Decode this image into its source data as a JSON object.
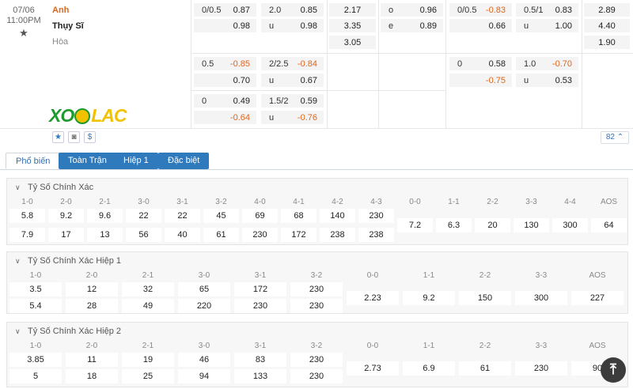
{
  "match": {
    "date": "07/06",
    "time": "11:00PM",
    "home": "Anh",
    "away": "Thụy Sĩ",
    "draw": "Hòa",
    "logo_left": "XO",
    "logo_right": "LAC",
    "more_count": "82"
  },
  "odds": {
    "r1": {
      "hdp": [
        "0/0.5",
        "0.87",
        "0.98"
      ],
      "ou": [
        "2.0",
        "0.85",
        "u",
        "0.98"
      ],
      "x12": [
        "2.17",
        "3.35",
        "3.05"
      ],
      "oe": [
        "o",
        "0.96",
        "e",
        "0.89"
      ],
      "hdp_h1": [
        "0/0.5",
        "-0.83",
        "0.66"
      ],
      "ou_h1": [
        "0.5/1",
        "0.83",
        "u",
        "1.00"
      ],
      "x12_h1": [
        "2.89",
        "4.40",
        "1.90"
      ]
    },
    "r2": {
      "hdp": [
        "0.5",
        "-0.85",
        "0.70"
      ],
      "ou": [
        "2/2.5",
        "-0.84",
        "u",
        "0.67"
      ],
      "hdp_h1": [
        "0",
        "0.58",
        "-0.75"
      ],
      "ou_h1": [
        "1.0",
        "-0.70",
        "u",
        "0.53"
      ]
    },
    "r3": {
      "hdp": [
        "0",
        "0.49",
        "-0.64"
      ],
      "ou": [
        "1.5/2",
        "0.59",
        "u",
        "-0.76"
      ]
    }
  },
  "tabs": [
    "Phổ biến",
    "Toàn Trận",
    "Hiệp 1",
    "Đặc biệt"
  ],
  "sections": [
    {
      "title": "Tỷ Số Chính Xác",
      "headers": [
        "1-0",
        "2-0",
        "2-1",
        "3-0",
        "3-1",
        "3-2",
        "4-0",
        "4-1",
        "4-2",
        "4-3",
        "0-0",
        "1-1",
        "2-2",
        "3-3",
        "4-4",
        "AOS"
      ],
      "home": [
        "5.8",
        "9.2",
        "9.6",
        "22",
        "22",
        "45",
        "69",
        "68",
        "140",
        "230"
      ],
      "away": [
        "7.9",
        "17",
        "13",
        "56",
        "40",
        "61",
        "230",
        "172",
        "238",
        "238"
      ],
      "draws": [
        "7.2",
        "6.3",
        "20",
        "130",
        "300",
        "64"
      ]
    },
    {
      "title": "Tỷ Số Chính Xác Hiệp 1",
      "headers": [
        "1-0",
        "2-0",
        "2-1",
        "3-0",
        "3-1",
        "3-2",
        "0-0",
        "1-1",
        "2-2",
        "3-3",
        "AOS"
      ],
      "home": [
        "3.5",
        "12",
        "32",
        "65",
        "172",
        "230"
      ],
      "away": [
        "5.4",
        "28",
        "49",
        "220",
        "230",
        "230"
      ],
      "draws": [
        "2.23",
        "9.2",
        "150",
        "300",
        "227"
      ]
    },
    {
      "title": "Tỷ Số Chính Xác Hiệp 2",
      "headers": [
        "1-0",
        "2-0",
        "2-1",
        "3-0",
        "3-1",
        "3-2",
        "0-0",
        "1-1",
        "2-2",
        "3-3",
        "AOS"
      ],
      "home": [
        "3.85",
        "11",
        "19",
        "46",
        "83",
        "230"
      ],
      "away": [
        "5",
        "18",
        "25",
        "94",
        "133",
        "230"
      ],
      "draws": [
        "2.73",
        "6.9",
        "61",
        "230",
        "90"
      ]
    }
  ],
  "icons": {
    "star": "star-icon",
    "stats": "stats-icon",
    "dollar": "dollar-icon",
    "back_to_top": "arrow-up-icon"
  }
}
